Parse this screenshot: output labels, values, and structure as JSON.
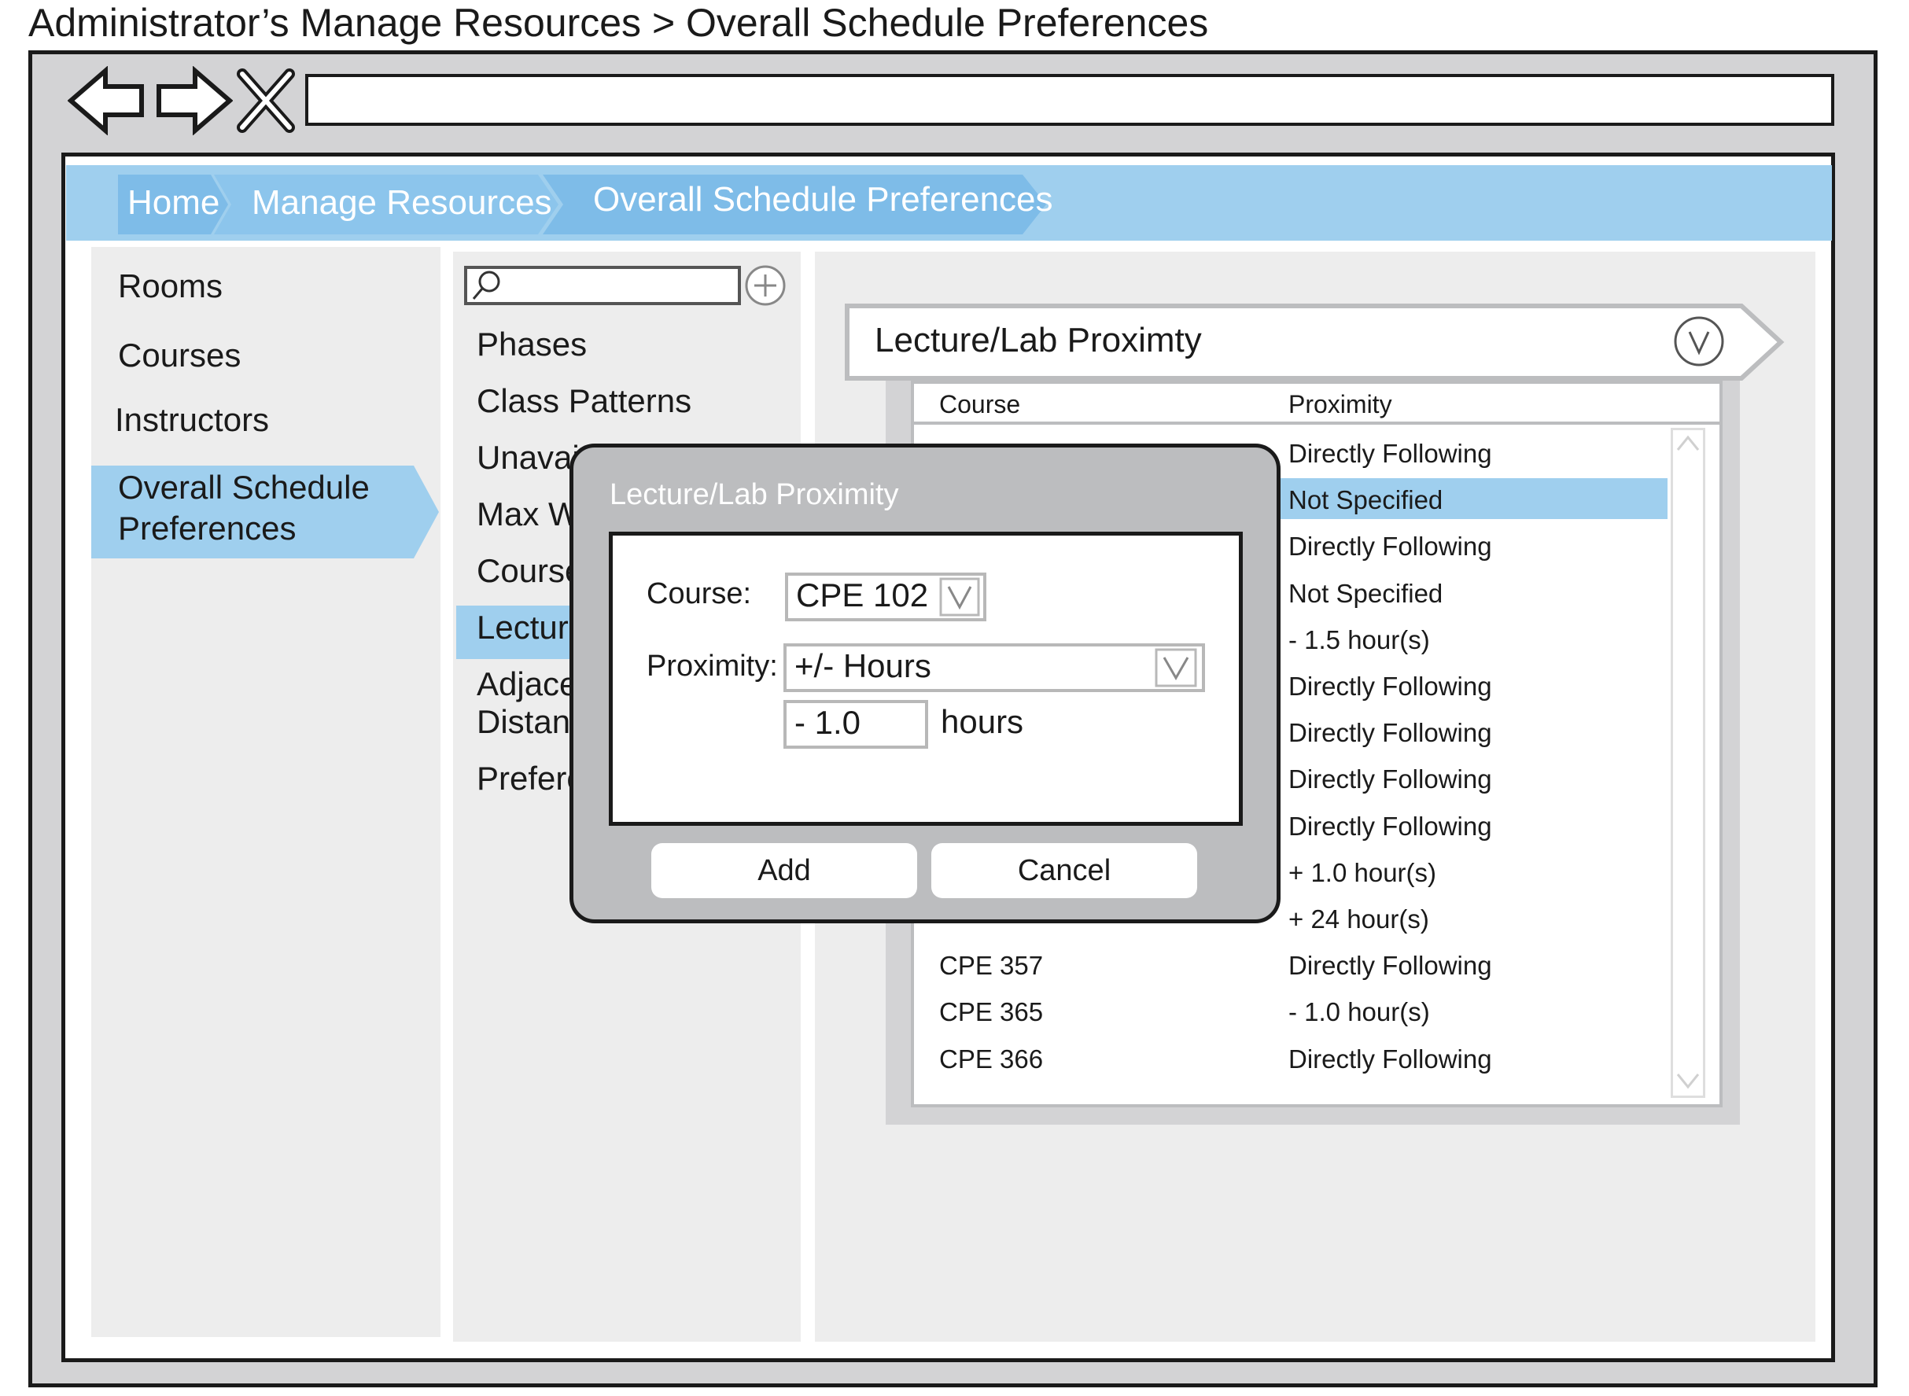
{
  "page_title": "Administrator’s Manage Resources > Overall Schedule Preferences",
  "breadcrumb": [
    "Home",
    "Manage Resources",
    "Overall Schedule Preferences"
  ],
  "sidebar": {
    "items": [
      "Rooms",
      "Courses",
      "Instructors"
    ],
    "active_line1": "Overall Schedule",
    "active_line2": "Preferences"
  },
  "middle": {
    "items": [
      "Phases",
      "Class Patterns",
      "Unavai",
      "Max W",
      "Course",
      "Lecture",
      "Adjace",
      "Distanc",
      "Prefere"
    ],
    "search_placeholder": ""
  },
  "section": {
    "title": "Lecture/Lab Proximty",
    "col_course": "Course",
    "col_proximity": "Proximity",
    "rows": [
      {
        "course": "",
        "proximity": "Directly Following"
      },
      {
        "course": "",
        "proximity": "Not Specified"
      },
      {
        "course": "",
        "proximity": "Directly Following"
      },
      {
        "course": "",
        "proximity": "Not Specified"
      },
      {
        "course": "",
        "proximity": "- 1.5 hour(s)"
      },
      {
        "course": "",
        "proximity": "Directly Following"
      },
      {
        "course": "",
        "proximity": "Directly Following"
      },
      {
        "course": "",
        "proximity": "Directly Following"
      },
      {
        "course": "",
        "proximity": "Directly Following"
      },
      {
        "course": "",
        "proximity": "+ 1.0 hour(s)"
      },
      {
        "course": "",
        "proximity": "+ 24 hour(s)"
      },
      {
        "course": "CPE 357",
        "proximity": "Directly Following"
      },
      {
        "course": "CPE 365",
        "proximity": "- 1.0 hour(s)"
      },
      {
        "course": "CPE 366",
        "proximity": "Directly Following"
      }
    ]
  },
  "dialog": {
    "title": "Lecture/Lab Proximity",
    "course_label": "Course:",
    "course_value": "CPE 102",
    "proximity_label": "Proximity:",
    "proximity_value": "+/- Hours",
    "hours_value": "- 1.0",
    "hours_unit": "hours",
    "add_label": "Add",
    "cancel_label": "Cancel"
  },
  "colors": {
    "accent": "#9fcfee",
    "panel": "#ededed",
    "dialog": "#bcbdbf"
  }
}
